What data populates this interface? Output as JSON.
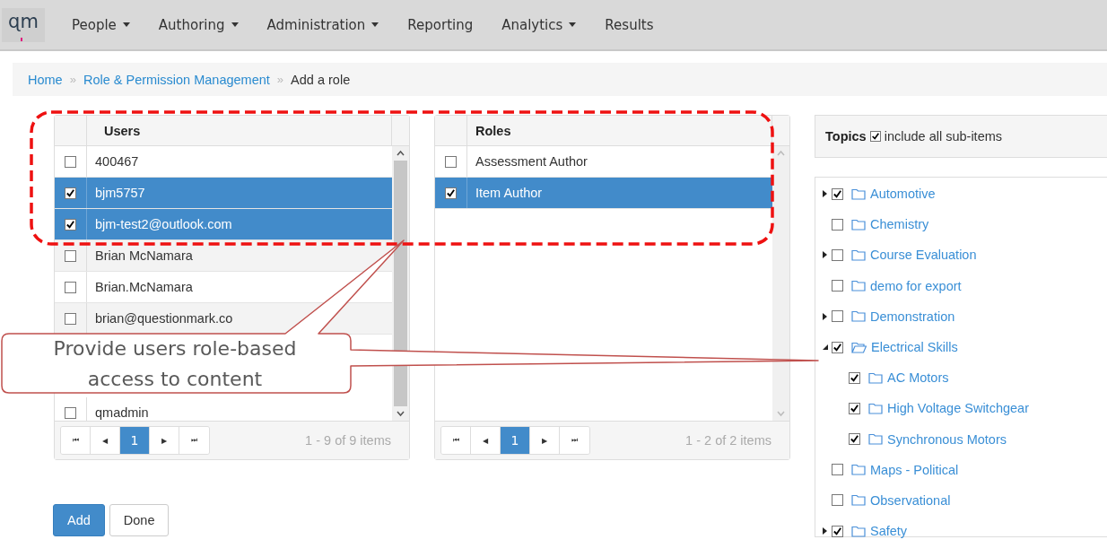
{
  "nav": {
    "logo": "ɋm",
    "items": [
      {
        "label": "People",
        "dropdown": true
      },
      {
        "label": "Authoring",
        "dropdown": true
      },
      {
        "label": "Administration",
        "dropdown": true
      },
      {
        "label": "Reporting",
        "dropdown": false
      },
      {
        "label": "Analytics",
        "dropdown": true
      },
      {
        "label": "Results",
        "dropdown": false
      }
    ]
  },
  "breadcrumb": [
    {
      "label": "Home",
      "link": true
    },
    {
      "label": "Role & Permission Management",
      "link": true
    },
    {
      "label": "Add a role",
      "link": false
    }
  ],
  "breadcrumb_separator": "»",
  "users": {
    "heading": "Users",
    "rows": [
      {
        "name": "400467",
        "checked": false,
        "selected": false
      },
      {
        "name": "bjm5757",
        "checked": true,
        "selected": true
      },
      {
        "name": "bjm-test2@outlook.com",
        "checked": true,
        "selected": true
      },
      {
        "name": "Brian McNamara",
        "checked": false,
        "selected": false
      },
      {
        "name": "Brian.McNamara",
        "checked": false,
        "selected": false
      },
      {
        "name": "brian@questionmark.co",
        "checked": false,
        "selected": false
      },
      {
        "name": "qmadmin",
        "checked": false,
        "selected": false
      }
    ],
    "pager": {
      "first": "⏮",
      "prev": "◀",
      "page": "1",
      "next": "▶",
      "last": "⏭"
    },
    "summary": "1 - 9 of 9 items"
  },
  "roles": {
    "heading": "Roles",
    "rows": [
      {
        "name": "Assessment Author",
        "checked": false,
        "selected": false
      },
      {
        "name": "Item Author",
        "checked": true,
        "selected": true
      }
    ],
    "pager": {
      "first": "⏮",
      "prev": "◀",
      "page": "1",
      "next": "▶",
      "last": "⏭"
    },
    "summary": "1 - 2 of 2 items"
  },
  "topics": {
    "title": "Topics",
    "include_sub_items": {
      "label": "include all sub-items",
      "checked": true
    },
    "tree": [
      {
        "label": "Automotive",
        "kind": "branch",
        "expanded": false,
        "checked": true
      },
      {
        "label": "Chemistry",
        "kind": "leaf",
        "checked": false
      },
      {
        "label": "Course Evaluation",
        "kind": "branch",
        "expanded": false,
        "checked": false
      },
      {
        "label": "demo for export",
        "kind": "leaf",
        "checked": false
      },
      {
        "label": "Demonstration",
        "kind": "branch",
        "expanded": false,
        "checked": false
      },
      {
        "label": "Electrical Skills",
        "kind": "branch",
        "expanded": true,
        "checked": true,
        "children": [
          {
            "label": "AC Motors",
            "kind": "leaf",
            "checked": true
          },
          {
            "label": "High Voltage Switchgear",
            "kind": "leaf",
            "checked": true
          },
          {
            "label": "Synchronous Motors",
            "kind": "leaf",
            "checked": true
          }
        ]
      },
      {
        "label": "Maps - Political",
        "kind": "leaf",
        "checked": false
      },
      {
        "label": "Observational",
        "kind": "leaf",
        "checked": false
      },
      {
        "label": "Safety",
        "kind": "branch",
        "expanded": false,
        "checked": true
      }
    ]
  },
  "buttons": [
    {
      "label": "Add",
      "primary": true
    },
    {
      "label": "Done",
      "primary": false
    }
  ],
  "callout": "Provide users role-based access to content"
}
